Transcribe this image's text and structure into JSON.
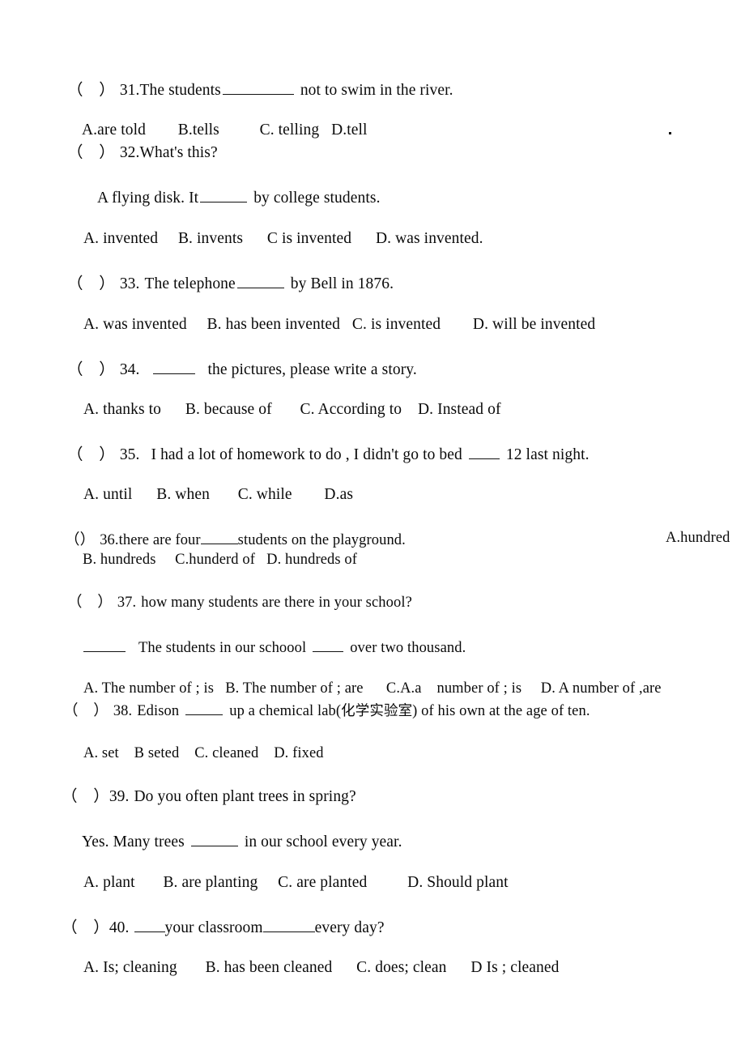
{
  "document": {
    "kind": "english-grammar-worksheet",
    "page_background": "#ffffff",
    "text_color": "#0a0a0a"
  },
  "stray_marks": {
    "period_right_of_q31_options": "."
  },
  "questions": [
    {
      "id": "q31",
      "marker": "（　）",
      "number": "31.",
      "stem_before": "The students",
      "stem_after": "not to swim in the river.",
      "options_line": "A.are told        B.tells          C. telling   D.tell",
      "options": [
        "A.are told",
        "B.tells",
        "C. telling",
        "D.tell"
      ]
    },
    {
      "id": "q32",
      "marker": "（　）",
      "number": "32.",
      "stem": "What's this?",
      "answer_before": "A flying disk. It",
      "answer_after": "by college students.",
      "options_line": "A. invented     B. invents      C is invented      D. was invented.",
      "options": [
        "A. invented",
        "B. invents",
        "C is invented",
        "D. was invented."
      ]
    },
    {
      "id": "q33",
      "marker": "（　）",
      "number": "33.",
      "stem_before": "The telephone",
      "stem_after": "by Bell in 1876.",
      "options_line": "A. was invented     B. has been invented   C. is invented        D. will be invented",
      "options": [
        "A. was invented",
        "B. has been invented",
        "C. is invented",
        "D. will be invented"
      ]
    },
    {
      "id": "q34",
      "marker": "（　）",
      "number": "34.",
      "stem_before": "",
      "stem_after": "the pictures, please write a story.",
      "options_line": "A. thanks to      B. because of       C. According to    D. Instead of",
      "options": [
        "A. thanks to",
        "B. because of",
        "C. According to",
        "D. Instead of"
      ]
    },
    {
      "id": "q35",
      "marker": "（　）",
      "number": "35.",
      "stem_before": "I had a lot of homework to do , I didn't go to bed",
      "stem_after": "12 last night.",
      "options_line": "A. until      B. when       C. while        D.as",
      "options": [
        "A. until",
        "B. when",
        "C. while",
        "D.as"
      ]
    },
    {
      "id": "q36",
      "marker": "（）",
      "number": "36.",
      "stem_before": "there are four",
      "stem_after": "students on the playground.",
      "option_a_right": "A.hundred",
      "options_line": "B. hundreds     C.hunderd of   D. hundreds of",
      "options": [
        "A.hundred",
        "B. hundreds",
        "C.hunderd of",
        "D. hundreds of"
      ]
    },
    {
      "id": "q37",
      "marker": "（　）",
      "number": "37.",
      "stem": "how many students are there in your school?",
      "answer_before": "",
      "answer_middle": "The students in our schoool",
      "answer_after": "over two thousand.",
      "options_line": "A. The number of ; is   B. The number of ; are      C.A.a    number of ; is     D. A number of ,are",
      "options": [
        "A. The number of ; is",
        "B. The number of ; are",
        "C.A.a    number of ; is",
        "D. A number of ,are"
      ]
    },
    {
      "id": "q38",
      "marker": "（　）",
      "number": "38.",
      "stem_before": "Edison",
      "stem_middle": "up a chemical lab(",
      "stem_cjk": "化学实验室",
      "stem_after": ") of his own at the age of ten.",
      "options_line": "A. set    B seted    C. cleaned    D. fixed",
      "options": [
        "A. set",
        "B seted",
        "C. cleaned",
        "D. fixed"
      ]
    },
    {
      "id": "q39",
      "marker": "（　）",
      "number": "39.",
      "stem": "Do you often plant trees in spring?",
      "answer_before": "Yes. Many trees",
      "answer_after": "in our school every year.",
      "options_line": "A. plant       B. are planting     C. are planted          D. Should plant",
      "options": [
        "A. plant",
        "B. are planting",
        "C. are planted",
        "D. Should plant"
      ]
    },
    {
      "id": "q40",
      "marker": "（　）",
      "number": "40.",
      "stem_before": "",
      "stem_middle": "your classroom",
      "stem_after": "every day?",
      "options_line": "A. Is; cleaning       B. has been cleaned      C. does; clean      D Is ; cleaned",
      "options": [
        "A. Is; cleaning",
        "B. has been cleaned",
        "C. does; clean",
        "D Is ; cleaned"
      ]
    }
  ]
}
